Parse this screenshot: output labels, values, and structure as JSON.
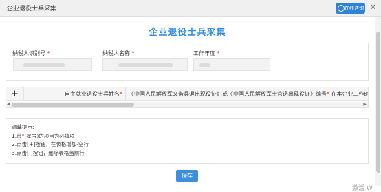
{
  "window": {
    "title": "企业退役士兵采集",
    "online_consult_label": "在线咨询",
    "close_label": "×"
  },
  "page_title": "企业退役士兵采集",
  "form": {
    "fields": [
      {
        "label": "纳税人识别号",
        "required_mark": "*"
      },
      {
        "label": "纳税人名称",
        "required_mark": "*"
      },
      {
        "label": "工作年度",
        "required_mark": "*"
      }
    ]
  },
  "grid": {
    "add_label": "+",
    "columns": [
      {
        "label": "自主就业退役士兵姓名",
        "required_mark": "*"
      },
      {
        "label": "《中国人民解放军义务兵退出现役证》或《中国人民解放军士官退出现役证》编号",
        "required_mark": "*",
        "suffix": "在本企业工作时间（"
      }
    ],
    "scroll_left": "◀",
    "scroll_right": "▶"
  },
  "tips": {
    "title": "温馨提示:",
    "items": [
      {
        "prefix": "1.带",
        "mark": "*",
        "suffix": "(星号)的项目为必填项"
      },
      {
        "text": "2.点击[+]按钮，在表格增加-空行"
      },
      {
        "text": "3.点击[-]按钮，删除表格当前行"
      }
    ]
  },
  "save_label": "保存",
  "watermark": "激活 W"
}
